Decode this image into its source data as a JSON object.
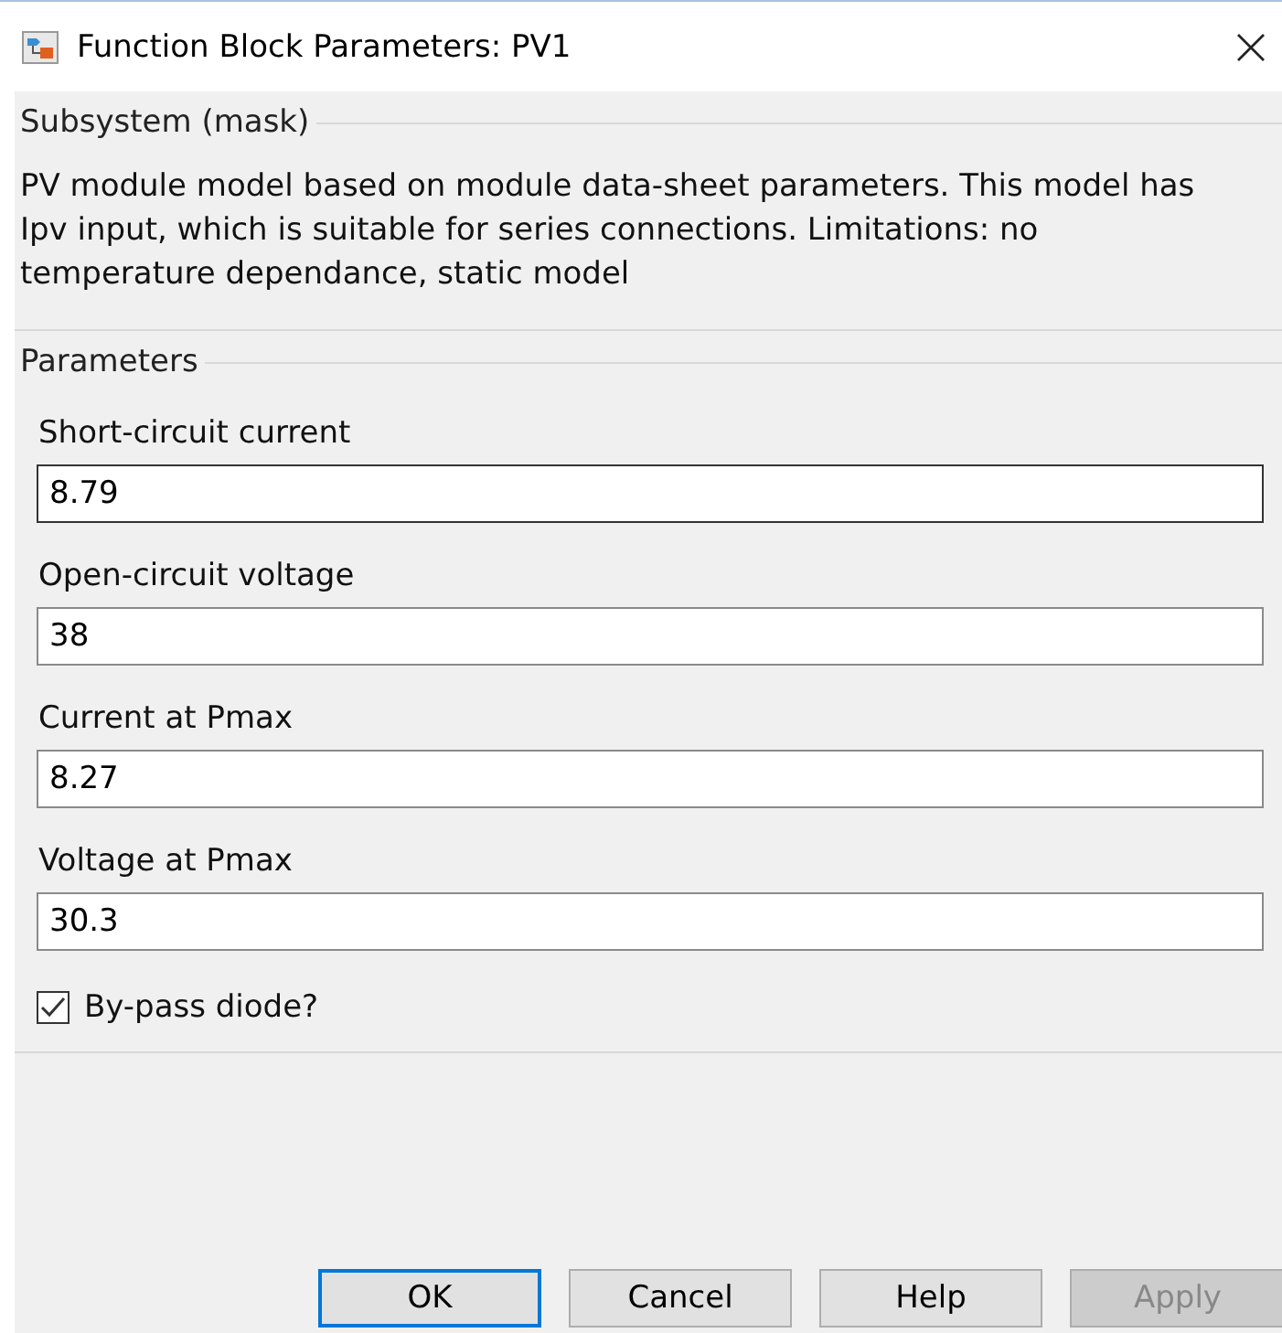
{
  "window": {
    "title": "Function Block Parameters: PV1"
  },
  "description_group": {
    "title": "Subsystem (mask)",
    "text": "PV module model based on module data-sheet parameters. This model has Ipv input, which is suitable for series connections. Limitations: no temperature dependance, static model"
  },
  "parameters_group": {
    "title": "Parameters",
    "fields": [
      {
        "label": "Short-circuit current",
        "value": "8.79",
        "focused": true
      },
      {
        "label": "Open-circuit voltage",
        "value": "38",
        "focused": false
      },
      {
        "label": "Current at Pmax",
        "value": "8.27",
        "focused": false
      },
      {
        "label": "Voltage at Pmax",
        "value": "30.3",
        "focused": false
      }
    ],
    "checkbox": {
      "label": "By-pass diode?",
      "checked": true
    }
  },
  "buttons": [
    {
      "label": "OK",
      "default": true,
      "disabled": false
    },
    {
      "label": "Cancel",
      "default": false,
      "disabled": false
    },
    {
      "label": "Help",
      "default": false,
      "disabled": false
    },
    {
      "label": "Apply",
      "default": false,
      "disabled": true
    }
  ]
}
